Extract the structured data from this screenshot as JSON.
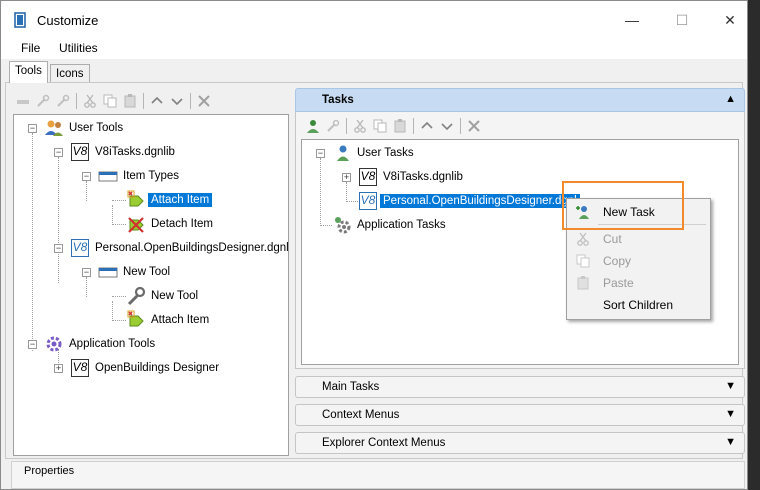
{
  "window": {
    "title": "Customize"
  },
  "menu": [
    "File",
    "Utilities"
  ],
  "tabs": [
    "Tools",
    "Icons"
  ],
  "left_tree": {
    "user_tools": "User Tools",
    "v8i_tasks": "V8iTasks.dgnlib",
    "item_types": "Item Types",
    "attach_item": "Attach Item",
    "detach_item": "Detach Item",
    "personal_lib": "Personal.OpenBuildingsDesigner.dgnlib",
    "new_tool_group": "New Tool",
    "new_tool": "New Tool",
    "attach_item_2": "Attach Item",
    "app_tools": "Application Tools",
    "openbuildings": "OpenBuildings Designer"
  },
  "tasks_panel": {
    "title": "Tasks",
    "tree": {
      "user_tasks": "User Tasks",
      "v8i_tasks": "V8iTasks.dgnlib",
      "personal_lib": "Personal.OpenBuildingsDesigner.dgnl",
      "app_tasks": "Application Tasks"
    }
  },
  "sections": [
    "Main Tasks",
    "Context Menus",
    "Explorer Context Menus"
  ],
  "context_menu": {
    "new_task": "New Task",
    "cut": "Cut",
    "copy": "Copy",
    "paste": "Paste",
    "sort_children": "Sort Children"
  },
  "properties_label": "Properties",
  "icons": {
    "app": "customize-app-icon",
    "user_tools": "users-icon",
    "library": "v8-library-icon",
    "item_types": "toolbox-icon",
    "attach": "attach-item-icon",
    "detach": "detach-item-icon",
    "tool": "wrench-icon",
    "app_tools": "gear-icon"
  },
  "colors": {
    "selection": "#0078d7",
    "tasks_header": "#c7dcf2",
    "highlight_box": "#f08a2c"
  }
}
